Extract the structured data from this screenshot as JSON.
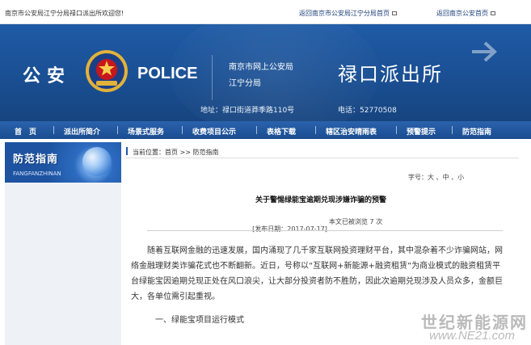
{
  "topbar": {
    "welcome": "南京市公安局江宁分局禄口派出所欢迎您!",
    "link_main": "返回南京市公安局江宁分局首页",
    "link_city": "返回南京公安首页"
  },
  "banner": {
    "gongan": "公安",
    "police": "POLICE",
    "org_line1": "南京市网上公安局",
    "org_line2": "江宁分局",
    "station": "禄口派出所",
    "address": "地址：禄口街道莽季路110号",
    "phone": "电话：52770508"
  },
  "nav": [
    "首　页",
    "派出所简介",
    "场景式服务",
    "收费项目公示",
    "表格下载",
    "辖区治安晴雨表",
    "预警提示",
    "防范指南"
  ],
  "sidebar": {
    "title": "防范指南",
    "pinyin": "FANGFANZHINAN"
  },
  "content": {
    "breadcrumb": "当前位置：首页 >> 防范指南",
    "fontsize": "字号：大 、中 、小",
    "title": "关于警惕绿能宝逾期兑现涉嫌诈骗的预警",
    "publish_date": "[发布日期：2017-07-17]",
    "views": "本文已被浏览 7 次",
    "paragraph": "随着互联网金融的迅速发展，国内涌现了几千家互联网投资理财平台，其中混杂着不少诈骗网站，网络金融理财类诈骗花式也不断翻新。近日，号称以“互联网+新能源+融资租赁”为商业模式的融资租赁平台绿能宝因逾期兑现正处在风口浪尖，让大部分投资者防不胜防，因此次逾期兑现涉及人员众多，金额巨大，各单位需引起重视。",
    "subheading": "一、绿能宝项目运行模式"
  },
  "watermark": {
    "line1": "世纪新能源网",
    "line2": "www.NE21.com"
  },
  "colors": {
    "banner_blue": "#1a4f93",
    "nav_blue": "#1f5ba6",
    "emblem_red": "#c8161d",
    "emblem_gold": "#e2b23a"
  }
}
